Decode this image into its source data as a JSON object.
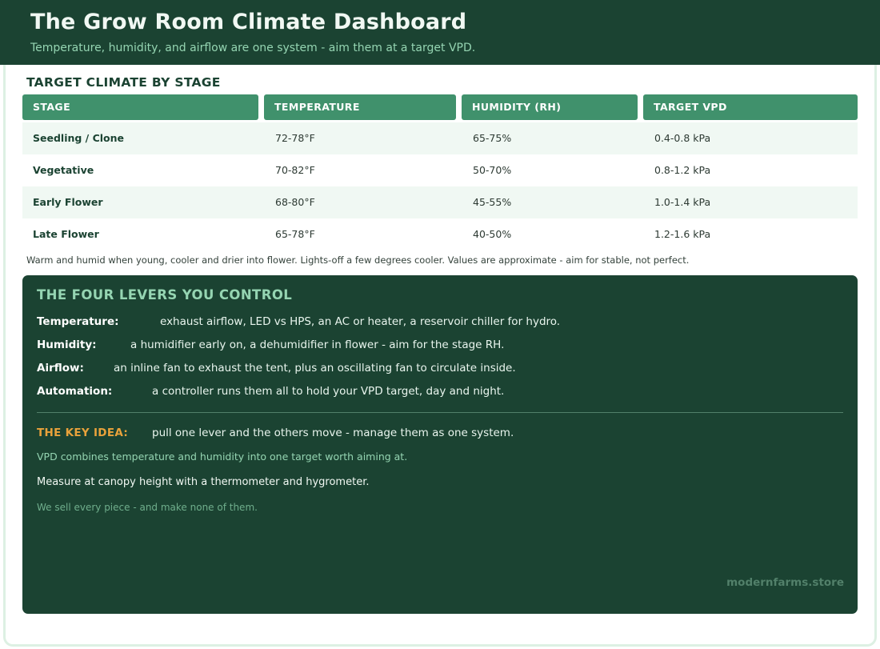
{
  "header": {
    "title": "The Grow Room Climate Dashboard",
    "subtitle": "Temperature, humidity, and airflow are one system - aim them at a target VPD."
  },
  "table": {
    "title": "TARGET CLIMATE BY STAGE",
    "columns": [
      "STAGE",
      "TEMPERATURE",
      "HUMIDITY (RH)",
      "TARGET VPD"
    ],
    "rows": [
      {
        "stage": "Seedling / Clone",
        "temperature": "72-78°F",
        "humidity": "65-75%",
        "vpd": "0.4-0.8 kPa"
      },
      {
        "stage": "Vegetative",
        "temperature": "70-82°F",
        "humidity": "50-70%",
        "vpd": "0.8-1.2 kPa"
      },
      {
        "stage": "Early Flower",
        "temperature": "68-80°F",
        "humidity": "45-55%",
        "vpd": "1.0-1.4 kPa"
      },
      {
        "stage": "Late Flower",
        "temperature": "65-78°F",
        "humidity": "40-50%",
        "vpd": "1.2-1.6 kPa"
      }
    ],
    "note": "Warm and humid when young, cooler and drier into flower. Lights-off a few degrees cooler. Values are approximate - aim for stable, not perfect."
  },
  "levers": {
    "title": "THE FOUR LEVERS YOU CONTROL",
    "items": [
      {
        "label": "Temperature:",
        "text": "exhaust airflow, LED vs HPS, an AC or heater, a reservoir chiller for hydro."
      },
      {
        "label": "Humidity:",
        "text": "a humidifier early on, a dehumidifier in flower - aim for the stage RH."
      },
      {
        "label": "Airflow:",
        "text": "an inline fan to exhaust the tent, plus an oscillating fan to circulate inside."
      },
      {
        "label": "Automation:",
        "text": "a controller runs them all to hold your VPD target, day and night."
      }
    ],
    "key_label": "THE KEY IDEA:",
    "key_text": "pull one lever and the others move - manage them as one system.",
    "vpd_note": "VPD combines temperature and humidity into one target worth aiming at.",
    "measure": "Measure at canopy height with a thermometer and hygrometer.",
    "sell": "We sell every piece - and make none of them.",
    "brand": "modernfarms.store"
  },
  "colors": {
    "dark_green": "#1b4332",
    "header_green": "#40916c",
    "mint": "#95d5b2",
    "accent_orange": "#e9a23b"
  }
}
